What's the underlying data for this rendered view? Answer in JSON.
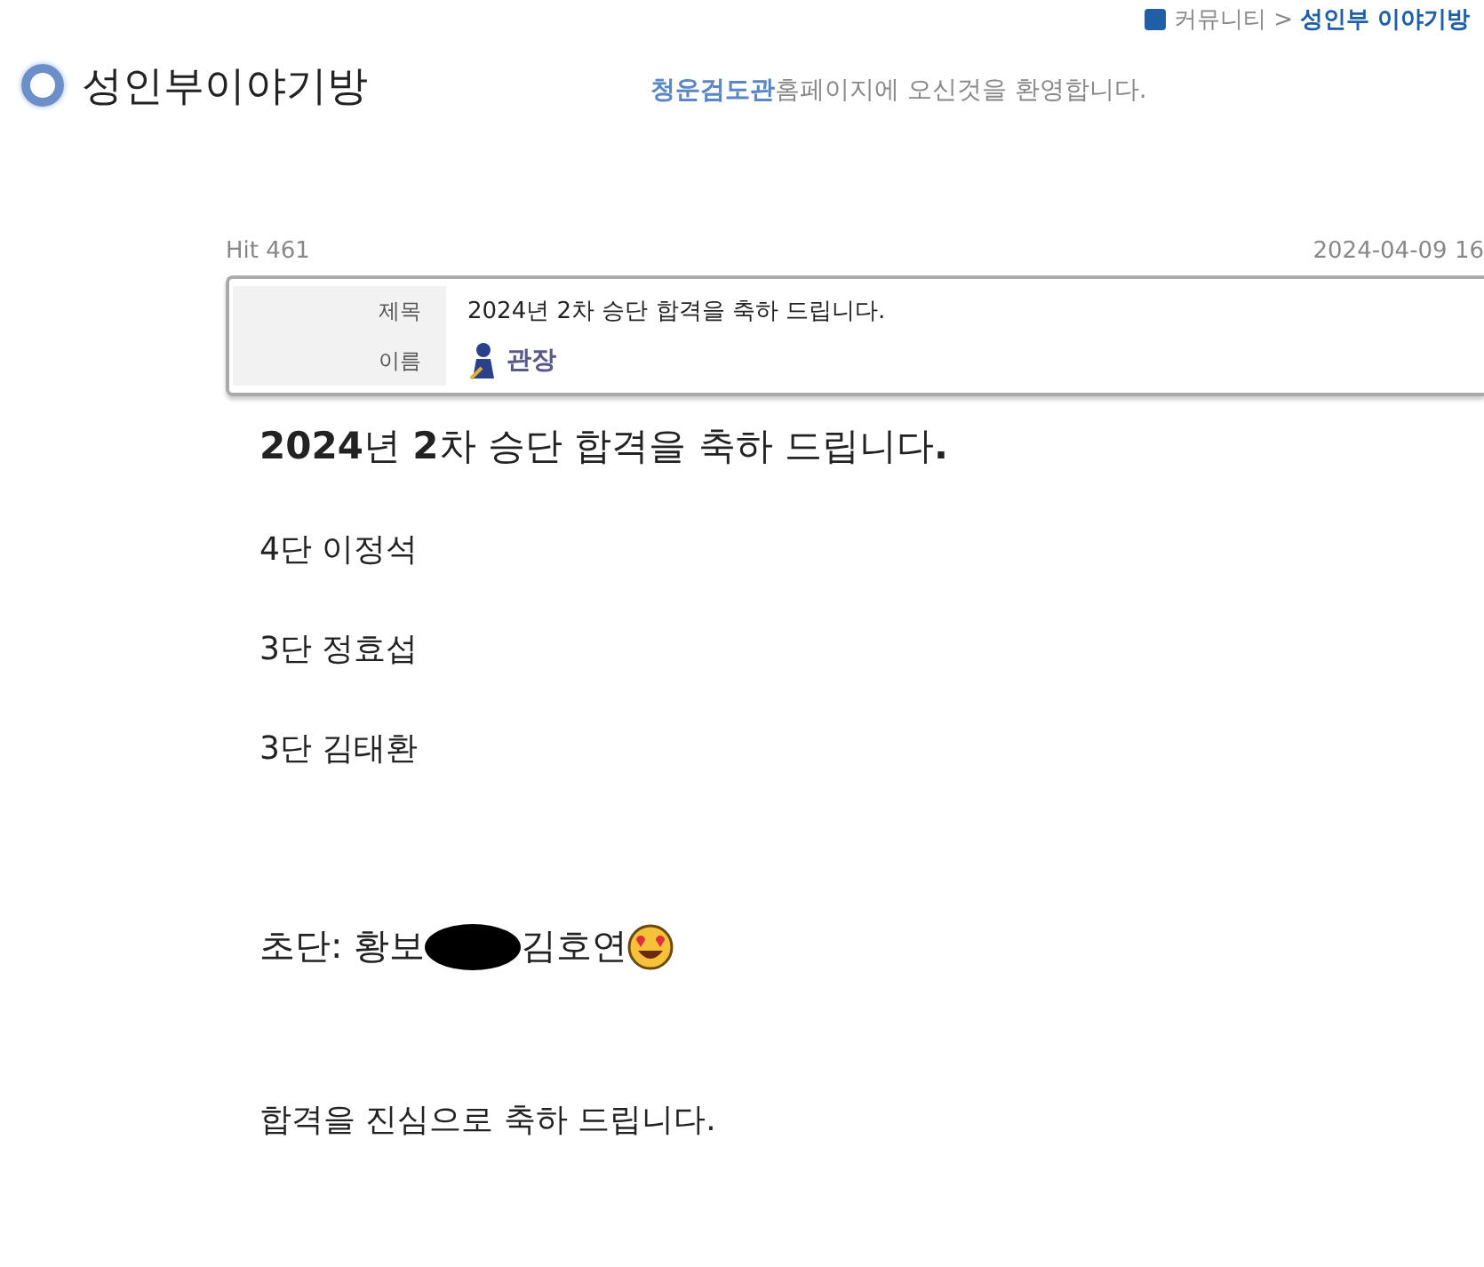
{
  "breadcrumb": {
    "parent": "커뮤니티 >",
    "current": "성인부 이야기방"
  },
  "board_title": "성인부이야기방",
  "welcome": {
    "name": "청운검도관",
    "text": "홈페이지에 오신것을 환영합니다."
  },
  "post": {
    "hits": "Hit 461",
    "date": "2024-04-09 16",
    "fields": [
      {
        "label": "제목",
        "kind": "text",
        "value": "2024년 2차 승단 합격을 축하 드립니다."
      },
      {
        "label": "이름",
        "kind": "author",
        "value": "관장"
      }
    ],
    "body": [
      {
        "kind": "heading",
        "text": "**2024**년 **2**차 승단 합격을 축하 드립니다**.**"
      },
      {
        "kind": "line",
        "text": "4단 이정석"
      },
      {
        "kind": "line",
        "text": "3단 정효섭"
      },
      {
        "kind": "line",
        "text": "3단 김태환"
      },
      {
        "kind": "redacted",
        "before": "초단: 황보",
        "after": "김호연"
      },
      {
        "kind": "closing",
        "text": "합격을 진심으로 축하 드립니다."
      }
    ]
  }
}
